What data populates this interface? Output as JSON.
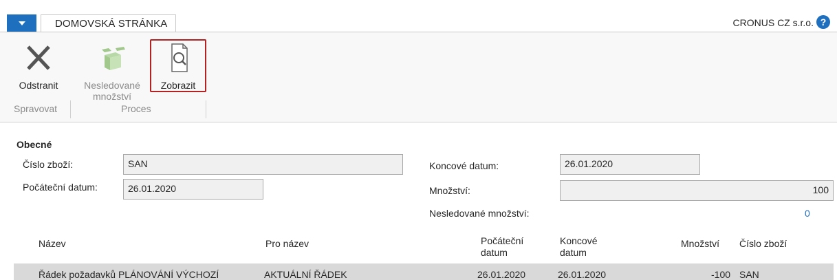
{
  "header": {
    "tab_home": "DOMOVSKÁ STRÁNKA",
    "company": "CRONUS CZ s.r.o.",
    "help": "?"
  },
  "ribbon": {
    "delete_label": "Odstranit",
    "untracked_label": "Nesledované množství",
    "show_label": "Zobrazit",
    "group_manage": "Spravovat",
    "group_process": "Proces"
  },
  "general": {
    "title": "Obecné",
    "item_no_label": "Číslo zboží:",
    "item_no_value": "SAN",
    "start_date_label": "Počáteční datum:",
    "start_date_value": "26.01.2020",
    "end_date_label": "Koncové datum:",
    "end_date_value": "26.01.2020",
    "quantity_label": "Množství:",
    "quantity_value": "100",
    "untracked_qty_label": "Nesledované množství:",
    "untracked_qty_value": "0"
  },
  "table": {
    "headers": {
      "name": "Název",
      "for_name": "Pro název",
      "start_date": "Počáteční datum",
      "end_date": "Koncové datum",
      "quantity": "Množství",
      "item_no": "Číslo zboží"
    },
    "rows": [
      {
        "name": "Řádek požadavků PLÁNOVÁNÍ VÝCHOZÍ",
        "for_name": "AKTUÁLNÍ ŘÁDEK",
        "start_date": "26.01.2020",
        "end_date": "26.01.2020",
        "quantity": "-100",
        "item_no": "SAN"
      }
    ]
  },
  "colors": {
    "accent": "#1f6fbf",
    "highlight": "#b22222"
  }
}
